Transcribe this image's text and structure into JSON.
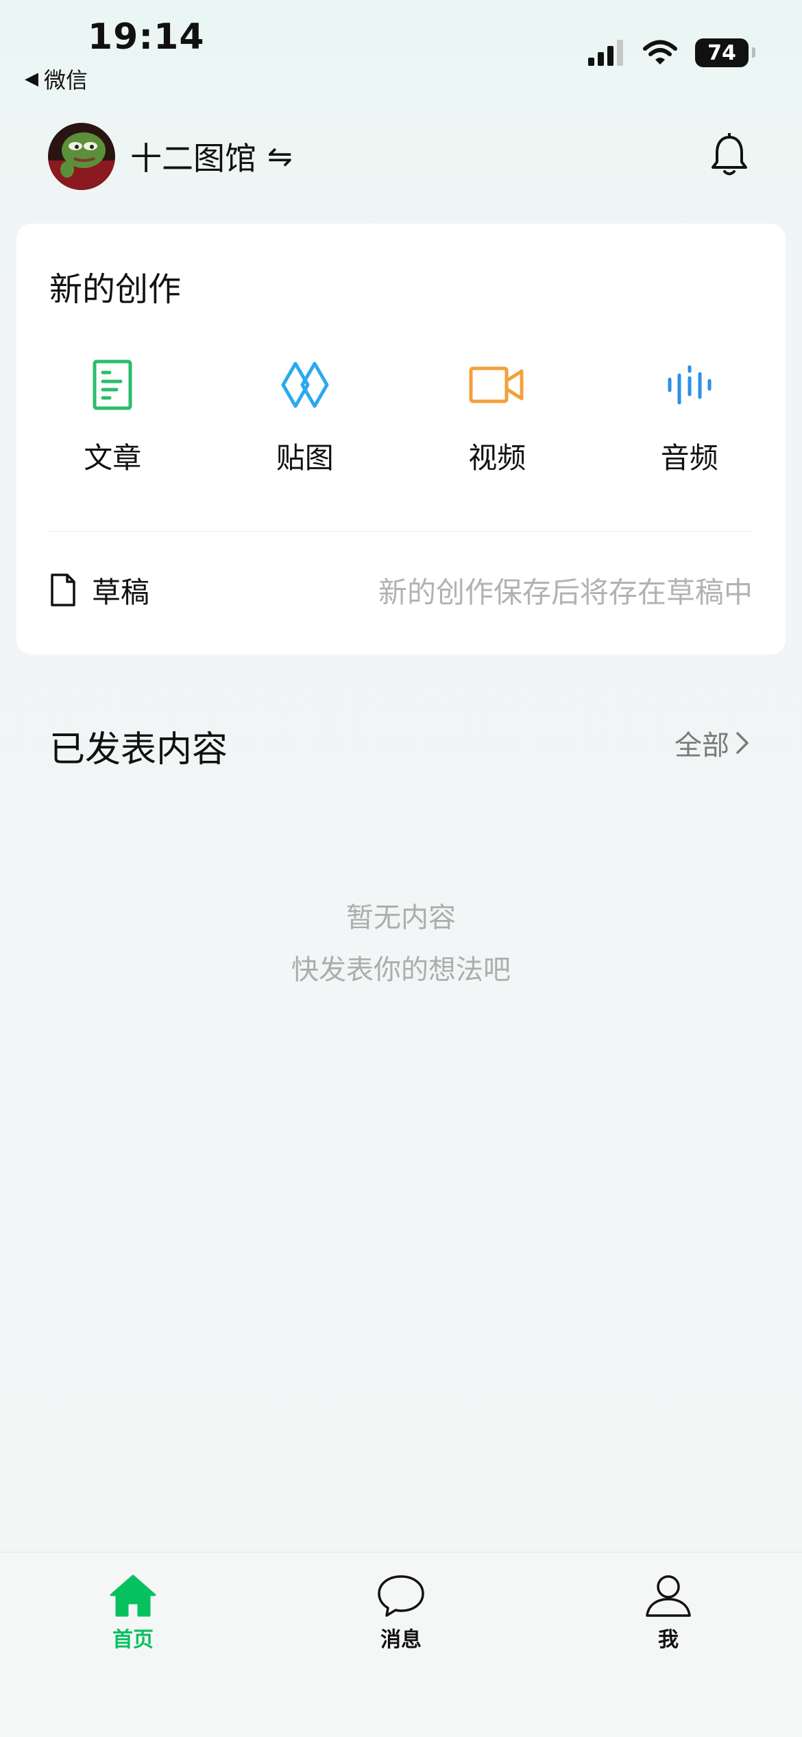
{
  "status_bar": {
    "time": "19:14",
    "back_app": "微信",
    "battery": "74",
    "icons": [
      "signal-icon",
      "wifi-icon",
      "battery-icon"
    ]
  },
  "account": {
    "name": "十二图馆",
    "switch_icon": "⇋"
  },
  "create_card": {
    "title": "新的创作",
    "items": [
      {
        "label": "文章",
        "icon": "article-icon",
        "color": "#2bbd6e"
      },
      {
        "label": "贴图",
        "icon": "image-post-icon",
        "color": "#2aa9ef"
      },
      {
        "label": "视频",
        "icon": "video-icon",
        "color": "#f3a03c"
      },
      {
        "label": "音频",
        "icon": "audio-icon",
        "color": "#2d8fe8"
      }
    ],
    "drafts_label": "草稿",
    "drafts_hint": "新的创作保存后将存在草稿中"
  },
  "published": {
    "title": "已发表内容",
    "all_label": "全部",
    "empty_line1": "暂无内容",
    "empty_line2": "快发表你的想法吧"
  },
  "tabs": [
    {
      "label": "首页",
      "icon": "home-icon",
      "active": true
    },
    {
      "label": "消息",
      "icon": "message-icon",
      "active": false
    },
    {
      "label": "我",
      "icon": "person-icon",
      "active": false
    }
  ],
  "colors": {
    "accent": "#07c160",
    "hint_gray": "#b2b2b2"
  }
}
